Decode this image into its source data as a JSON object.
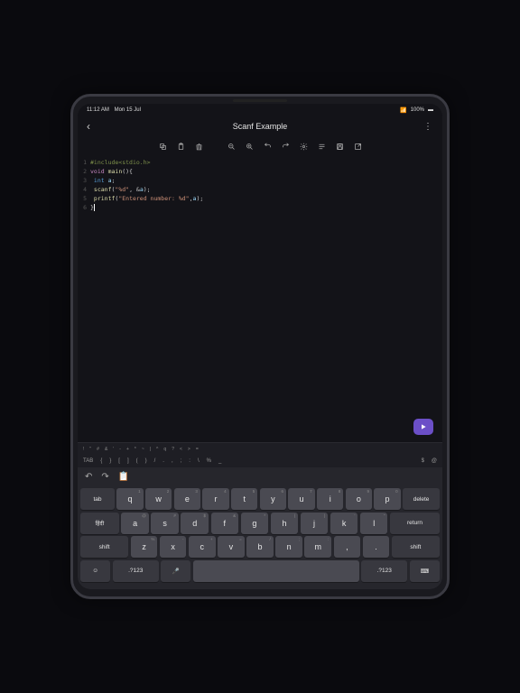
{
  "status": {
    "time": "11:12 AM",
    "date": "Mon 15 Jul",
    "network": "📶",
    "battery_pct": "100%",
    "battery_icon": "▮"
  },
  "header": {
    "title": "Scanf Example",
    "back": "‹",
    "more": "⋮"
  },
  "toolbar": {
    "icons": [
      "copy",
      "paste",
      "delete",
      "zoom-out",
      "zoom-in",
      "undo",
      "redo",
      "settings",
      "format",
      "save",
      "open"
    ]
  },
  "code": {
    "lines": [
      {
        "n": "1",
        "tokens": [
          {
            "t": "#include<stdio.h>",
            "c": "tok-include"
          }
        ]
      },
      {
        "n": "2",
        "tokens": [
          {
            "t": "void",
            "c": "tok-keyword"
          },
          {
            "t": " ",
            "c": ""
          },
          {
            "t": "main",
            "c": "tok-func"
          },
          {
            "t": "(){",
            "c": "tok-punct"
          }
        ]
      },
      {
        "n": "3",
        "tokens": [
          {
            "t": " ",
            "c": ""
          },
          {
            "t": "int",
            "c": "tok-type"
          },
          {
            "t": " ",
            "c": ""
          },
          {
            "t": "a",
            "c": "tok-var"
          },
          {
            "t": ";",
            "c": "tok-punct"
          }
        ]
      },
      {
        "n": "4",
        "tokens": [
          {
            "t": " ",
            "c": ""
          },
          {
            "t": "scanf",
            "c": "tok-func"
          },
          {
            "t": "(",
            "c": "tok-punct"
          },
          {
            "t": "\"%d\"",
            "c": "tok-string"
          },
          {
            "t": ", &",
            "c": "tok-punct"
          },
          {
            "t": "a",
            "c": "tok-var"
          },
          {
            "t": ");",
            "c": "tok-punct"
          }
        ]
      },
      {
        "n": "5",
        "tokens": [
          {
            "t": " ",
            "c": ""
          },
          {
            "t": "printf",
            "c": "tok-func"
          },
          {
            "t": "(",
            "c": "tok-punct"
          },
          {
            "t": "\"Entered number: %d\"",
            "c": "tok-string"
          },
          {
            "t": ",",
            "c": "tok-punct"
          },
          {
            "t": "a",
            "c": "tok-var"
          },
          {
            "t": ");",
            "c": "tok-punct"
          }
        ]
      },
      {
        "n": "6",
        "tokens": [
          {
            "t": "}",
            "c": "tok-punct"
          }
        ]
      }
    ]
  },
  "symbolbar1": [
    "!",
    "\"",
    "#",
    "&",
    "'",
    "-",
    "+",
    "*",
    "~",
    "|",
    "^",
    "q",
    "?",
    "<",
    ">",
    "="
  ],
  "symbolbar2": {
    "tab": "TAB",
    "keys": [
      "{",
      "}",
      "[",
      "]",
      "(",
      ")",
      "/",
      ".",
      ",",
      ";",
      ":",
      "\\",
      "%",
      "_"
    ],
    "right": [
      "$",
      "@"
    ]
  },
  "keyboard": {
    "row1": [
      {
        "main": "q",
        "sub": "1"
      },
      {
        "main": "w",
        "sub": "2"
      },
      {
        "main": "e",
        "sub": "3"
      },
      {
        "main": "r",
        "sub": "4"
      },
      {
        "main": "t",
        "sub": "5"
      },
      {
        "main": "y",
        "sub": "6"
      },
      {
        "main": "u",
        "sub": "7"
      },
      {
        "main": "i",
        "sub": "8"
      },
      {
        "main": "o",
        "sub": "9"
      },
      {
        "main": "p",
        "sub": "0"
      }
    ],
    "tab": "tab",
    "delete": "delete",
    "row2": [
      {
        "main": "a",
        "sub": "@"
      },
      {
        "main": "s",
        "sub": "#"
      },
      {
        "main": "d",
        "sub": "$"
      },
      {
        "main": "f",
        "sub": "&"
      },
      {
        "main": "g",
        "sub": "*"
      },
      {
        "main": "h",
        "sub": "("
      },
      {
        "main": "j",
        "sub": ")"
      },
      {
        "main": "k",
        "sub": "'"
      },
      {
        "main": "l",
        "sub": "\""
      }
    ],
    "caps_left": "हिंदी",
    "return": "return",
    "row3": [
      {
        "main": "z",
        "sub": "%"
      },
      {
        "main": "x",
        "sub": "-"
      },
      {
        "main": "c",
        "sub": "+"
      },
      {
        "main": "v",
        "sub": "="
      },
      {
        "main": "b",
        "sub": "/"
      },
      {
        "main": "n",
        "sub": ";"
      },
      {
        "main": "m",
        "sub": ":"
      }
    ],
    "shift": "shift",
    "row4": {
      "emoji": "☺",
      "numkey": ".?123",
      "mic": "🎤",
      "space": "",
      "numkey2": ".?123",
      "dismiss": "⌨"
    }
  }
}
